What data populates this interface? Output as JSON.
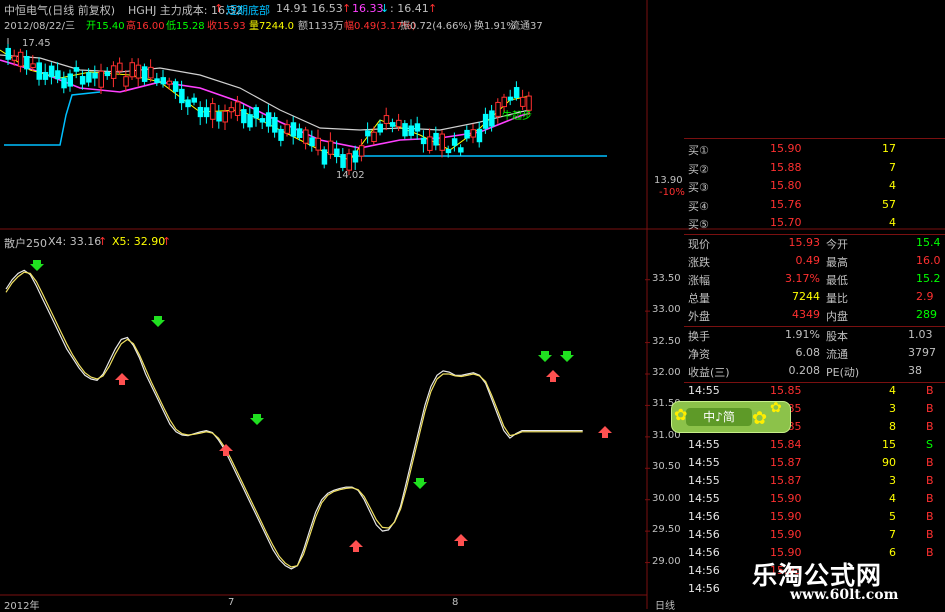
{
  "header": {
    "stock": "中恒电气(日线 前复权)",
    "date": "2012/08/22/三",
    "indicator_name": "HGHJ 主力成本: 16.32",
    "indicator_arrow": "↑",
    "bottom_label": "短期底部",
    "bottom_value": "14.91",
    "val1": ": 16.53",
    "val2": "16.33",
    "val3": ": 16.41",
    "open": "开15.40",
    "high": "高16.00",
    "low": "低15.28",
    "close": "收15.93",
    "volume": "量7244.0",
    "amount": "额1133万",
    "change": "幅0.49(3.17%)",
    "amplitude": "振0.72(4.66%)",
    "turnover": "换1.91%",
    "float_cap": "流通37",
    "max_label": "17.45",
    "min_label": "14.02",
    "trend_label": "牛起步",
    "side_price": "13.90",
    "side_pct": "-10%"
  },
  "oscillator": {
    "name": "散户250",
    "x4_label": "X4: 33.16",
    "x4_arrow": "↑",
    "x5_label": "X5: 32.90",
    "y_ticks": [
      "33.50",
      "33.00",
      "32.50",
      "32.00",
      "31.50",
      "31.00",
      "30.50",
      "30.00",
      "29.50",
      "29.00"
    ]
  },
  "chart_data": [
    {
      "type": "line",
      "title": "散户250",
      "ylim": [
        28.85,
        33.75
      ],
      "x": [
        0,
        1,
        2,
        3,
        4,
        5,
        6,
        7,
        8,
        9,
        10,
        11,
        12,
        13,
        14,
        15,
        16,
        17,
        18,
        19,
        20,
        21,
        22,
        23,
        24,
        25,
        26,
        27,
        28,
        29,
        30,
        31,
        32,
        33,
        34,
        35,
        36,
        37,
        38,
        39,
        40,
        41,
        42,
        43,
        44,
        45,
        46,
        47,
        48,
        49,
        50,
        51,
        52,
        53,
        54,
        55,
        56,
        57,
        58,
        59,
        60,
        61,
        62,
        63,
        64,
        65,
        66,
        67,
        68,
        69,
        70,
        71,
        72,
        73,
        74,
        75,
        76,
        77,
        78,
        79,
        80,
        81,
        82,
        83,
        84,
        85,
        86,
        87,
        88,
        89,
        90,
        91,
        92,
        93,
        94,
        95,
        96,
        97,
        98,
        99
      ],
      "series": [
        {
          "name": "X4",
          "values": [
            33.35,
            33.5,
            33.6,
            33.65,
            33.58,
            33.4,
            33.2,
            33.0,
            32.8,
            32.6,
            32.4,
            32.25,
            32.1,
            31.98,
            31.92,
            31.9,
            32.0,
            32.2,
            32.4,
            32.55,
            32.58,
            32.45,
            32.25,
            32.0,
            31.8,
            31.6,
            31.4,
            31.2,
            31.08,
            31.03,
            31.02,
            31.05,
            31.08,
            31.1,
            31.07,
            30.95,
            30.8,
            30.6,
            30.4,
            30.2,
            30.0,
            29.8,
            29.6,
            29.4,
            29.2,
            29.05,
            28.95,
            28.9,
            28.95,
            29.2,
            29.5,
            29.8,
            30.0,
            30.1,
            30.15,
            30.18,
            30.2,
            30.2,
            30.15,
            30.0,
            29.8,
            29.6,
            29.5,
            29.52,
            29.65,
            29.9,
            30.3,
            30.7,
            31.1,
            31.5,
            31.8,
            31.98,
            32.05,
            32.03,
            31.98,
            31.98,
            32.0,
            32.02,
            31.98,
            31.85,
            31.6,
            31.35,
            31.1,
            30.98,
            31.05,
            31.1,
            31.1,
            31.1,
            31.1,
            31.1,
            31.1,
            31.1,
            31.1,
            31.1,
            31.1,
            31.1,
            31.1,
            31.1,
            31.1,
            31.1
          ]
        },
        {
          "name": "X5",
          "values": [
            33.3,
            33.45,
            33.55,
            33.62,
            33.6,
            33.47,
            33.28,
            33.08,
            32.88,
            32.68,
            32.48,
            32.3,
            32.15,
            32.02,
            31.95,
            31.92,
            31.97,
            32.12,
            32.32,
            32.48,
            32.55,
            32.48,
            32.3,
            32.08,
            31.86,
            31.66,
            31.46,
            31.27,
            31.12,
            31.05,
            31.03,
            31.04,
            31.06,
            31.08,
            31.06,
            30.98,
            30.84,
            30.66,
            30.46,
            30.26,
            30.06,
            29.86,
            29.66,
            29.46,
            29.27,
            29.1,
            28.99,
            28.93,
            28.95,
            29.13,
            29.42,
            29.72,
            29.95,
            30.07,
            30.13,
            30.16,
            30.18,
            30.19,
            30.16,
            30.05,
            29.87,
            29.68,
            29.56,
            29.55,
            29.64,
            29.85,
            30.2,
            30.6,
            31.0,
            31.4,
            31.72,
            31.92,
            32.0,
            32.0,
            31.97,
            31.96,
            31.98,
            32.0,
            31.97,
            31.88,
            31.66,
            31.42,
            31.17,
            31.02,
            31.04,
            31.08,
            31.08,
            31.08,
            31.08,
            31.08,
            31.08,
            31.08,
            31.08,
            31.08,
            31.08,
            31.08,
            31.08,
            31.08,
            31.08,
            31.08
          ]
        }
      ]
    }
  ],
  "osc_marks": {
    "down": [
      [
        37,
        266
      ],
      [
        158,
        322
      ],
      [
        257,
        420
      ],
      [
        420,
        484
      ],
      [
        545,
        357
      ],
      [
        567,
        357
      ]
    ],
    "up": [
      [
        122,
        379
      ],
      [
        226,
        450
      ],
      [
        356,
        546
      ],
      [
        461,
        540
      ],
      [
        553,
        376
      ],
      [
        605,
        432
      ]
    ]
  },
  "quote": {
    "bids": [
      {
        "label": "买①",
        "price": "15.90",
        "vol": "17"
      },
      {
        "label": "买②",
        "price": "15.88",
        "vol": "7"
      },
      {
        "label": "买③",
        "price": "15.80",
        "vol": "4"
      },
      {
        "label": "买④",
        "price": "15.76",
        "vol": "57"
      },
      {
        "label": "买⑤",
        "price": "15.70",
        "vol": "4"
      }
    ],
    "stats": [
      {
        "l": "现价",
        "v": "15.93",
        "l2": "今开",
        "v2": "15.4"
      },
      {
        "l": "涨跌",
        "v": "0.49",
        "l2": "最高",
        "v2": "16.0"
      },
      {
        "l": "涨幅",
        "v": "3.17%",
        "l2": "最低",
        "v2": "15.2"
      },
      {
        "l": "总量",
        "v": "7244",
        "l2": "量比",
        "v2": "2.9"
      },
      {
        "l": "外盘",
        "v": "4349",
        "l2": "内盘",
        "v2": "289"
      }
    ],
    "info": [
      {
        "l": "换手",
        "v": "1.91%",
        "l2": "股本",
        "v2": "1.03"
      },
      {
        "l": "净资",
        "v": "6.08",
        "l2": "流通",
        "v2": "3797"
      },
      {
        "l": "收益(三)",
        "v": "0.208",
        "l2": "PE(动)",
        "v2": "38"
      }
    ],
    "ticks": [
      {
        "t": "14:55",
        "p": "15.85",
        "v": "4",
        "d": "B"
      },
      {
        "t": "14:55",
        "p": "15.85",
        "v": "3",
        "d": "B"
      },
      {
        "t": "14:55",
        "p": "15.85",
        "v": "8",
        "d": "B"
      },
      {
        "t": "14:55",
        "p": "15.84",
        "v": "15",
        "d": "S"
      },
      {
        "t": "14:55",
        "p": "15.87",
        "v": "90",
        "d": "B"
      },
      {
        "t": "14:55",
        "p": "15.87",
        "v": "3",
        "d": "B"
      },
      {
        "t": "14:55",
        "p": "15.90",
        "v": "4",
        "d": "B"
      },
      {
        "t": "14:56",
        "p": "15.90",
        "v": "5",
        "d": "B"
      },
      {
        "t": "14:56",
        "p": "15.90",
        "v": "7",
        "d": "B"
      },
      {
        "t": "14:56",
        "p": "15.90",
        "v": "6",
        "d": "B"
      },
      {
        "t": "14:56",
        "p": "15.93",
        "v": "",
        "d": ""
      },
      {
        "t": "14:56",
        "p": "",
        "v": "",
        "d": ""
      }
    ]
  },
  "badge": {
    "text": "中♪简"
  },
  "bottom_axis": {
    "year": "2012年",
    "m1": "7",
    "m2": "8",
    "period": "日线"
  },
  "watermark": {
    "cn": "乐淘公式网",
    "url": "www.60lt.com"
  }
}
